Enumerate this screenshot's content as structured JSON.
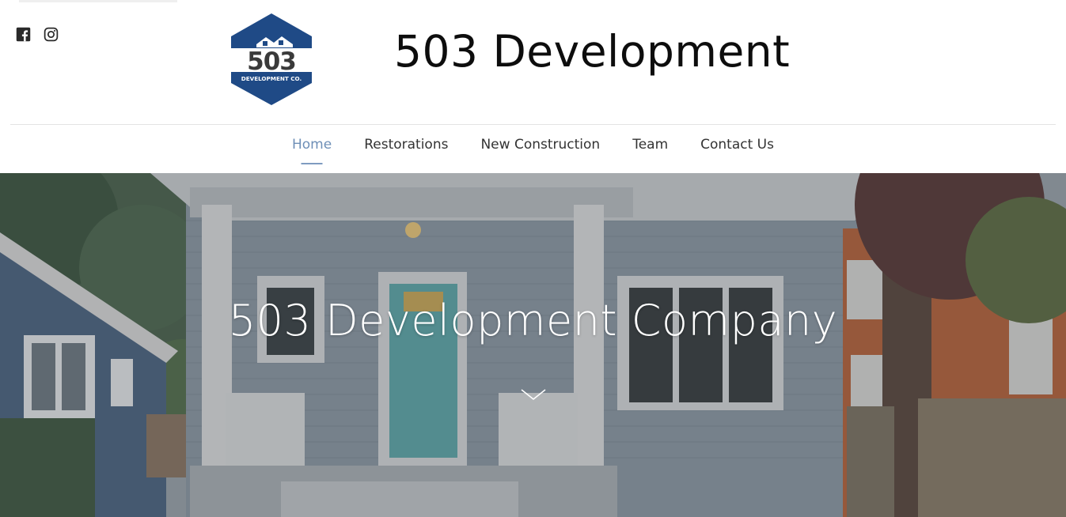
{
  "header": {
    "site_title": "503 Development",
    "logo": {
      "number_text": "503",
      "subtitle_text": "DEVELOPMENT CO.",
      "colors": {
        "hex": "#1f4a86",
        "number": "#3a3a3a",
        "white": "#ffffff"
      }
    },
    "social": [
      {
        "icon": "facebook-icon",
        "label": "Facebook"
      },
      {
        "icon": "instagram-icon",
        "label": "Instagram"
      }
    ]
  },
  "nav": {
    "items": [
      {
        "label": "Home",
        "active": true
      },
      {
        "label": "Restorations",
        "active": false
      },
      {
        "label": "New Construction",
        "active": false
      },
      {
        "label": "Team",
        "active": false
      },
      {
        "label": "Contact Us",
        "active": false
      }
    ],
    "active_color": "#6e8fb7"
  },
  "hero": {
    "title": "503 Development Company",
    "scroll_icon": "chevron-down-icon"
  }
}
